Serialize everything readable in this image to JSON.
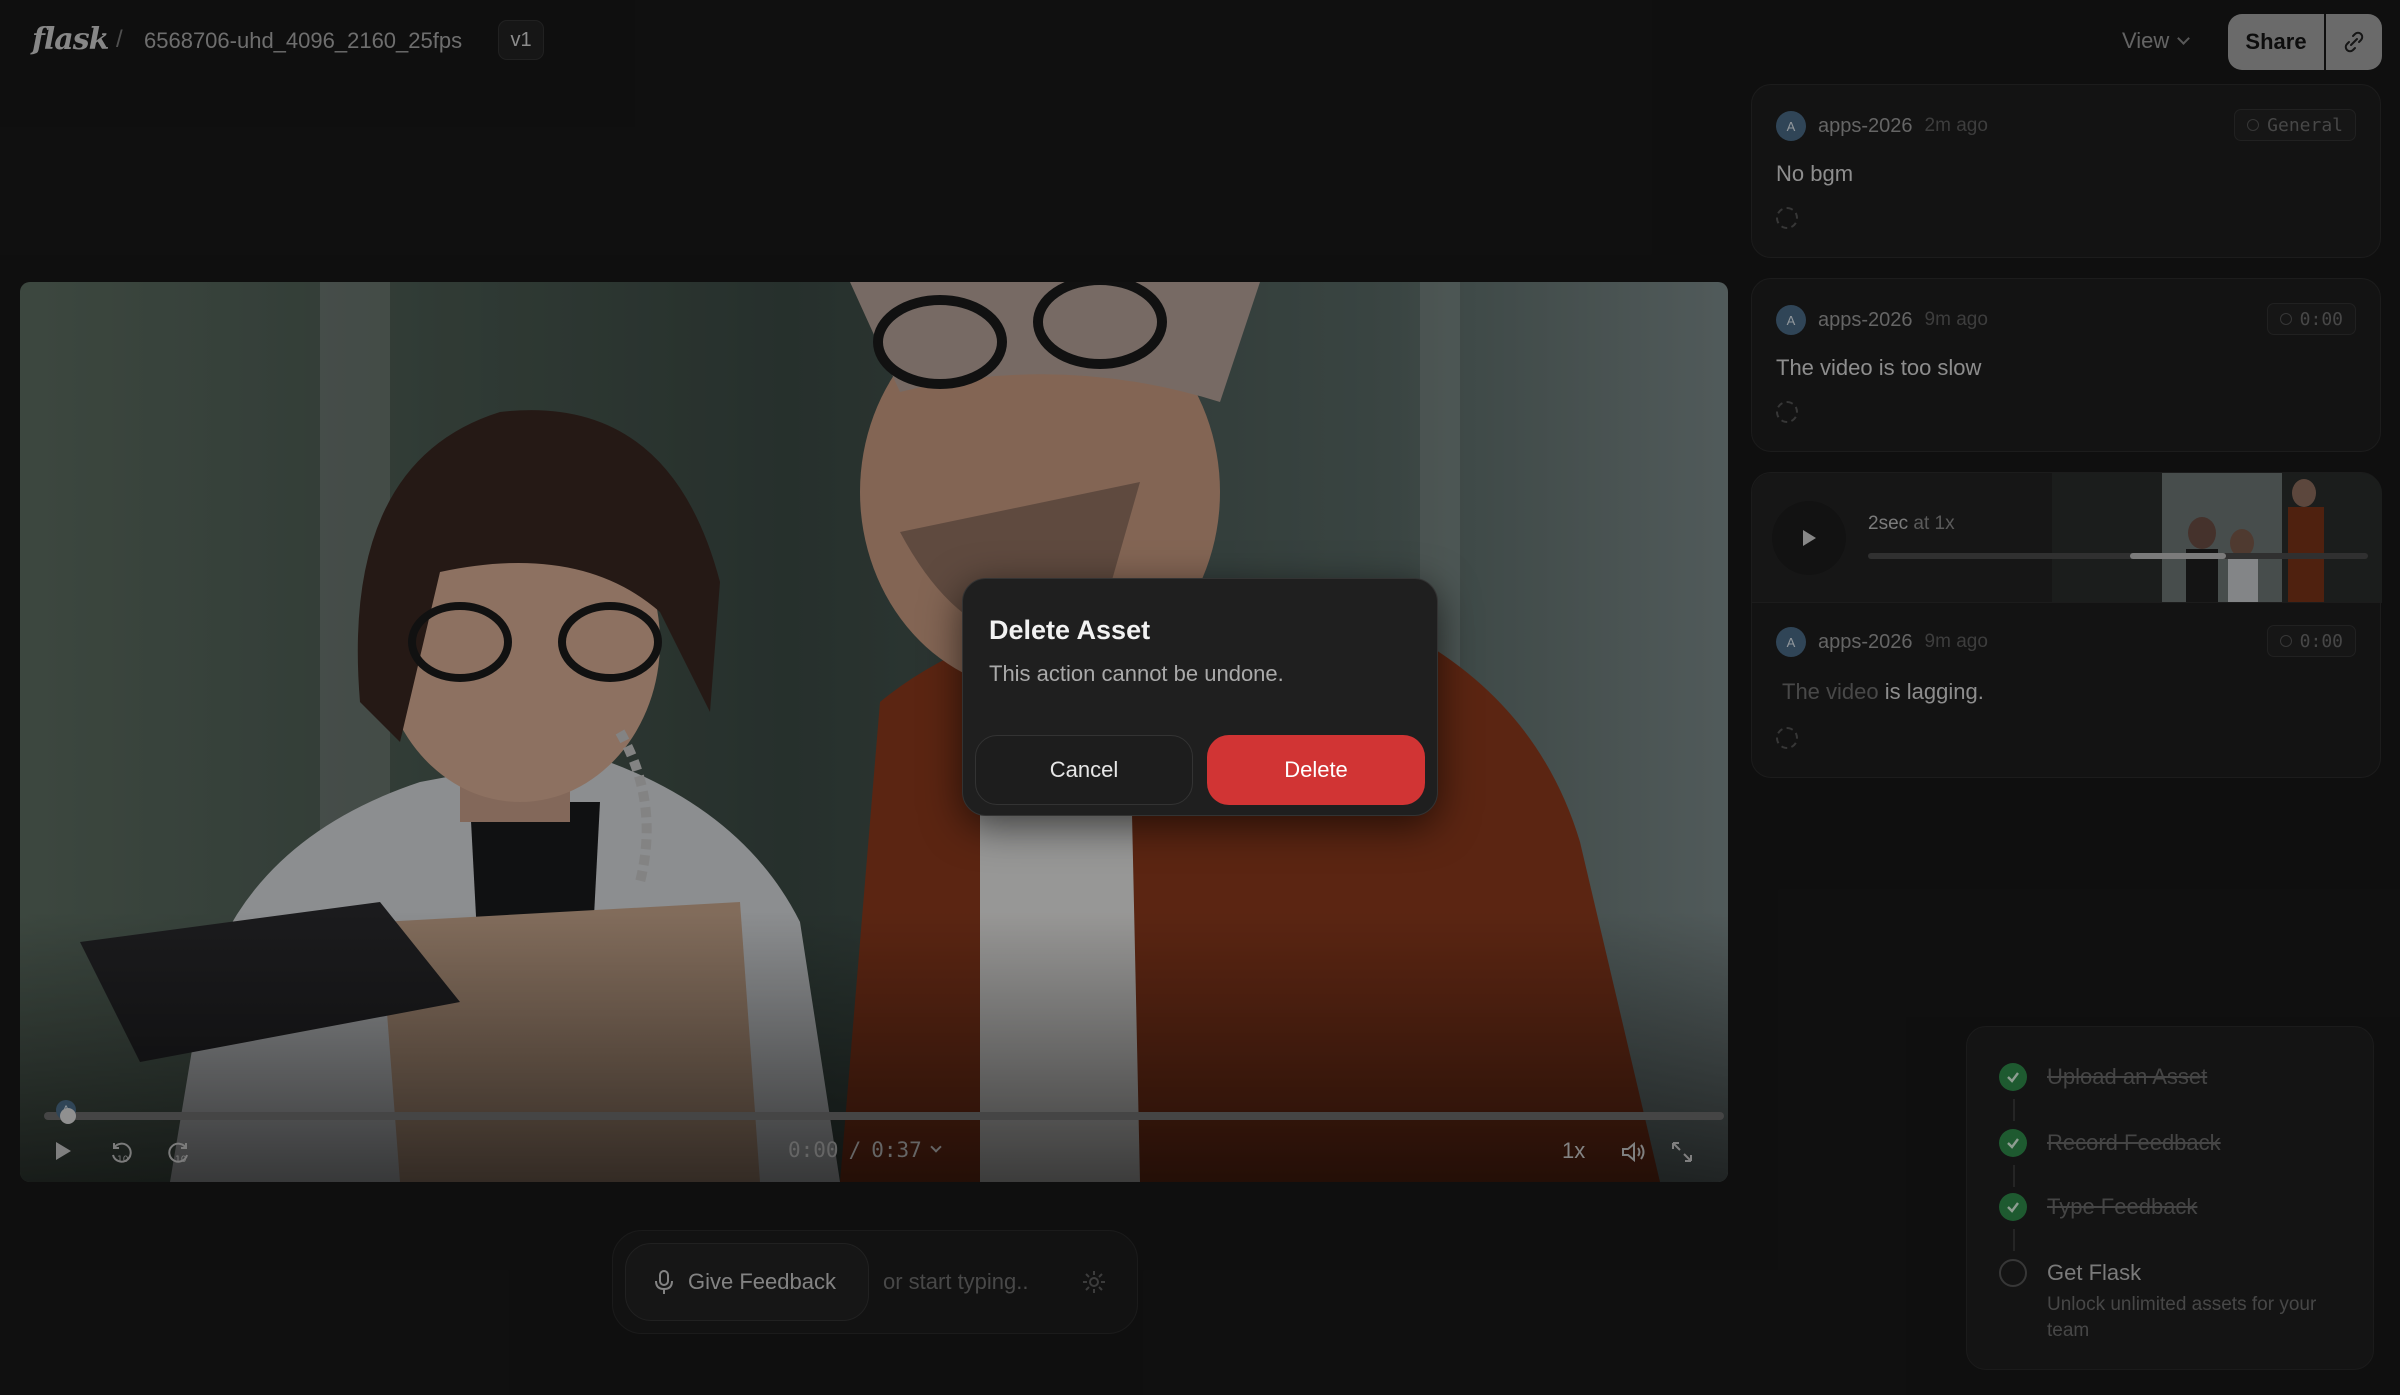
{
  "header": {
    "logo": "flask",
    "separator": "/",
    "asset_name": "6568706-uhd_4096_2160_25fps",
    "version": "v1",
    "view_label": "View",
    "share_label": "Share"
  },
  "player": {
    "marker_initial": "A",
    "current_time": "0:00",
    "time_separator": "/",
    "duration": "0:37",
    "speed": "1x",
    "progress_fraction": 0.0
  },
  "comments": [
    {
      "avatar": "A",
      "author": "apps-2026",
      "ago": "2m ago",
      "tag": "General",
      "text": "No bgm"
    },
    {
      "avatar": "A",
      "author": "apps-2026",
      "ago": "9m ago",
      "tag": "0:00",
      "text": "The video is too slow"
    },
    {
      "avatar": "A",
      "author": "apps-2026",
      "ago": "9m ago",
      "tag": "0:00",
      "text_muted": "The video",
      "text_rest": " is lagging.",
      "audio": {
        "duration_label": "2sec",
        "speed_label": "at 1x"
      }
    }
  ],
  "feedback": {
    "button_label": "Give Feedback",
    "placeholder": "or start typing.."
  },
  "checklist": [
    {
      "label": "Upload an Asset",
      "done": true
    },
    {
      "label": "Record Feedback",
      "done": true
    },
    {
      "label": "Type Feedback",
      "done": true
    },
    {
      "label": "Get Flask",
      "done": false,
      "description": "Unlock unlimited assets for your team"
    }
  ],
  "modal": {
    "title": "Delete Asset",
    "subtitle": "This action cannot be undone.",
    "cancel_label": "Cancel",
    "delete_label": "Delete"
  },
  "colors": {
    "background": "#181818",
    "danger": "#d13434",
    "success": "#2f8a4a",
    "avatar": "#4a6a86"
  }
}
